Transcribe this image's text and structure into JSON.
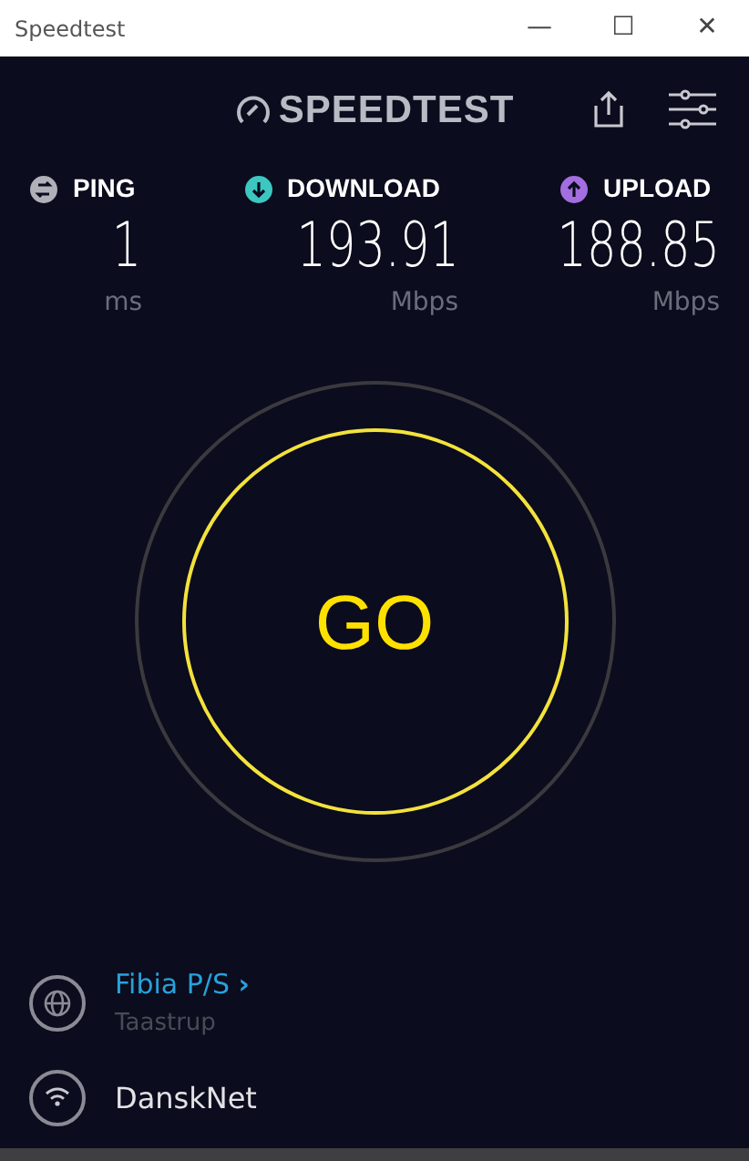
{
  "window": {
    "title": "Speedtest",
    "controls": [
      "—",
      "☐",
      "✕"
    ]
  },
  "header": {
    "logo": "SPEEDTEST"
  },
  "metrics": [
    {
      "kind": "ping",
      "label": "PING",
      "value": "1",
      "unit": "ms"
    },
    {
      "kind": "download",
      "label": "DOWNLOAD",
      "value": "193.91",
      "unit": "Mbps"
    },
    {
      "kind": "upload",
      "label": "UPLOAD",
      "value": "188.85",
      "unit": "Mbps"
    }
  ],
  "go_button": {
    "label": "GO"
  },
  "server": {
    "provider": "Fibia P/S",
    "arrow": "›",
    "location": "Taastrup"
  },
  "connection": {
    "name": "DanskNet"
  }
}
